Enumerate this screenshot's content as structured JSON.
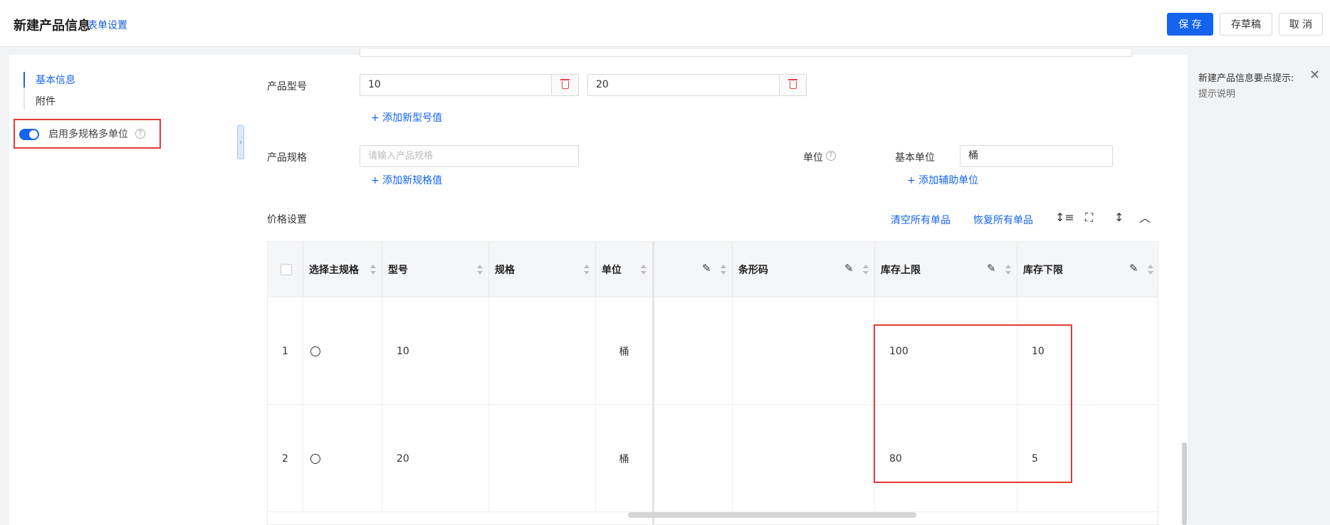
{
  "header": {
    "title": "新建产品信息",
    "form_settings": "表单设置",
    "save": "保 存",
    "draft": "存草稿",
    "cancel": "取 消"
  },
  "sidebar": {
    "items": [
      {
        "label": "基本信息",
        "active": true
      },
      {
        "label": "附件",
        "active": false
      }
    ],
    "toggle_label": "启用多规格多单位",
    "toggle_on": true
  },
  "form": {
    "model_label": "产品型号",
    "models": [
      "10",
      "20"
    ],
    "add_model": "+ 添加新型号值",
    "spec_label": "产品规格",
    "spec_placeholder": "请输入产品规格",
    "add_spec": "+ 添加新规格值",
    "unit_label": "单位",
    "base_unit_label": "基本单位",
    "base_unit_value": "桶",
    "add_aux_unit": "+ 添加辅助单位"
  },
  "price": {
    "title": "价格设置",
    "clear_all": "清空所有单品",
    "restore_all": "恢复所有单品"
  },
  "table": {
    "headers": [
      "选择主规格",
      "型号",
      "规格",
      "单位",
      "",
      "条形码",
      "库存上限",
      "库存下限"
    ],
    "rows": [
      {
        "index": "1",
        "model": "10",
        "spec": "",
        "unit": "桶",
        "barcode": "",
        "upper": "100",
        "lower": "10"
      },
      {
        "index": "2",
        "model": "20",
        "spec": "",
        "unit": "桶",
        "barcode": "",
        "upper": "80",
        "lower": "5"
      }
    ]
  },
  "tip": {
    "title": "新建产品信息要点提示:",
    "desc": "提示说明"
  },
  "colors": {
    "accent": "#1464f0",
    "highlight_border": "#e53935",
    "delete": "#e54545"
  }
}
